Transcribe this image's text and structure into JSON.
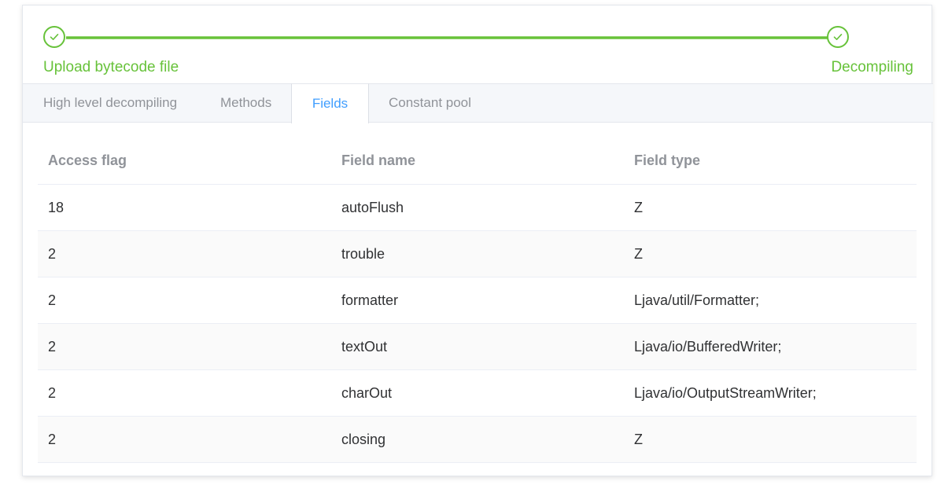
{
  "steps": [
    {
      "title": "Upload bytecode file",
      "status": "success",
      "icon": "check-icon"
    },
    {
      "title": "Decompiling",
      "status": "success",
      "icon": "check-icon"
    }
  ],
  "colors": {
    "success": "#67c23a",
    "active_tab": "#409eff",
    "muted_text": "#909399",
    "text": "#303133"
  },
  "tabs": [
    {
      "label": "High level decompiling"
    },
    {
      "label": "Methods"
    },
    {
      "label": "Fields",
      "active": true
    },
    {
      "label": "Constant pool"
    }
  ],
  "table": {
    "headers": [
      "Access flag",
      "Field name",
      "Field type"
    ],
    "rows": [
      [
        "18",
        "autoFlush",
        "Z"
      ],
      [
        "2",
        "trouble",
        "Z"
      ],
      [
        "2",
        "formatter",
        "Ljava/util/Formatter;"
      ],
      [
        "2",
        "textOut",
        "Ljava/io/BufferedWriter;"
      ],
      [
        "2",
        "charOut",
        "Ljava/io/OutputStreamWriter;"
      ],
      [
        "2",
        "closing",
        "Z"
      ]
    ]
  }
}
